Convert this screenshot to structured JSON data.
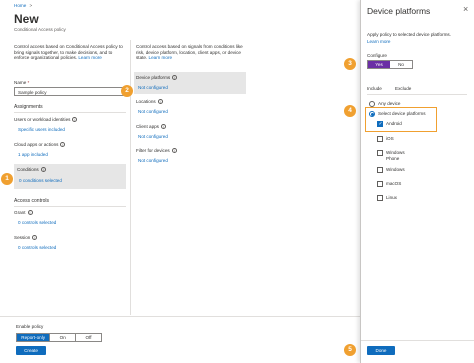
{
  "breadcrumb": {
    "home": "Home",
    "sep": ">"
  },
  "header": {
    "title": "New",
    "subtitle": "Conditional Access policy"
  },
  "left_intro": {
    "text": "Control access based on Conditional Access policy to bring signals together, to make decisions, and to enforce organizational policies.",
    "learn_more": "Learn more"
  },
  "name_field": {
    "label": "Name",
    "required": "*",
    "value": "Sample policy"
  },
  "assignments": {
    "heading": "Assignments",
    "users_label": "Users or workload identities",
    "users_value": "Specific users included",
    "apps_label": "Cloud apps or actions",
    "apps_value": "1 app included",
    "conditions_label": "Conditions",
    "conditions_value": "0 conditions selected"
  },
  "access_controls": {
    "heading": "Access controls",
    "grant_label": "Grant",
    "grant_value": "0 controls selected",
    "session_label": "Session",
    "session_value": "0 controls selected"
  },
  "middle": {
    "intro": "Control access based on signals from conditions like risk, device platform, location, client apps, or device state.",
    "learn_more": "Learn more",
    "items": [
      {
        "label": "Device platforms",
        "value": "Not configured"
      },
      {
        "label": "Locations",
        "value": "Not configured"
      },
      {
        "label": "Client apps",
        "value": "Not configured"
      },
      {
        "label": "Filter for devices",
        "value": "Not configured"
      }
    ]
  },
  "footer": {
    "enable_label": "Enable policy",
    "toggle": [
      "Report-only",
      "On",
      "Off"
    ],
    "create_label": "Create"
  },
  "panel": {
    "title": "Device platforms",
    "close": "×",
    "description": "Apply policy to selected device platforms.",
    "learn_more": "Learn more",
    "configure_label": "Configure",
    "configure_options": [
      "Yes",
      "No"
    ],
    "tabs": [
      "Include",
      "Exclude"
    ],
    "radio_any": "Any device",
    "radio_select": "Select device platforms",
    "platforms": [
      {
        "label": "Android",
        "checked": true
      },
      {
        "label": "iOS",
        "checked": false
      },
      {
        "label": "Windows Phone",
        "checked": false
      },
      {
        "label": "Windows",
        "checked": false
      },
      {
        "label": "macOS",
        "checked": false
      },
      {
        "label": "Linux",
        "checked": false
      }
    ],
    "done_label": "Done"
  },
  "callouts": [
    "1",
    "2",
    "3",
    "4",
    "5"
  ],
  "colors": {
    "accent": "#0f6cbd",
    "callout": "#f0a030",
    "highlight": "#e6e6e6",
    "toggle_on": "#6b2fa5",
    "required": "#a4262c"
  }
}
